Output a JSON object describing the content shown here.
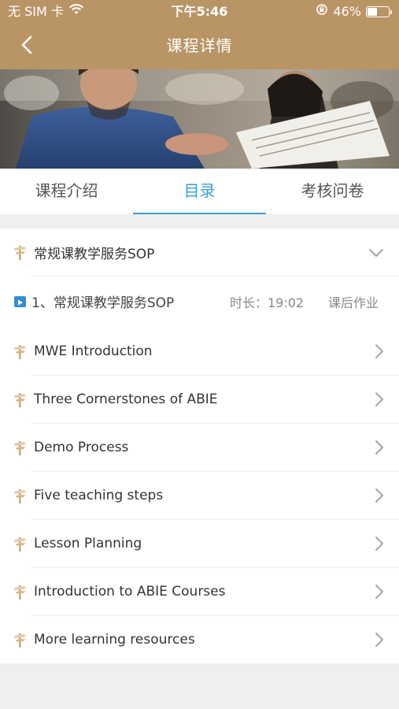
{
  "status_bar": {
    "carrier": "无 SIM 卡",
    "time": "下午5:46",
    "battery_percent_text": "46%",
    "battery_level": 0.46
  },
  "nav": {
    "title": "课程详情"
  },
  "tabs": [
    {
      "label": "课程介绍",
      "active": false
    },
    {
      "label": "目录",
      "active": true
    },
    {
      "label": "考核问卷",
      "active": false
    }
  ],
  "catalog": {
    "section_title": "常规课教学服务SOP",
    "lesson": {
      "label": "1、常规课教学服务SOP",
      "duration": "时长：19:02",
      "homework": "课后作业"
    },
    "items": [
      "MWE Introduction",
      "Three Cornerstones of ABIE",
      "Demo Process",
      "Five teaching steps",
      "Lesson Planning",
      "Introduction to ABIE Courses",
      "More learning resources"
    ]
  },
  "colors": {
    "header": "#b99566",
    "accent": "#3aa0d9",
    "lesson_play_icon": "#2f8fd6"
  }
}
